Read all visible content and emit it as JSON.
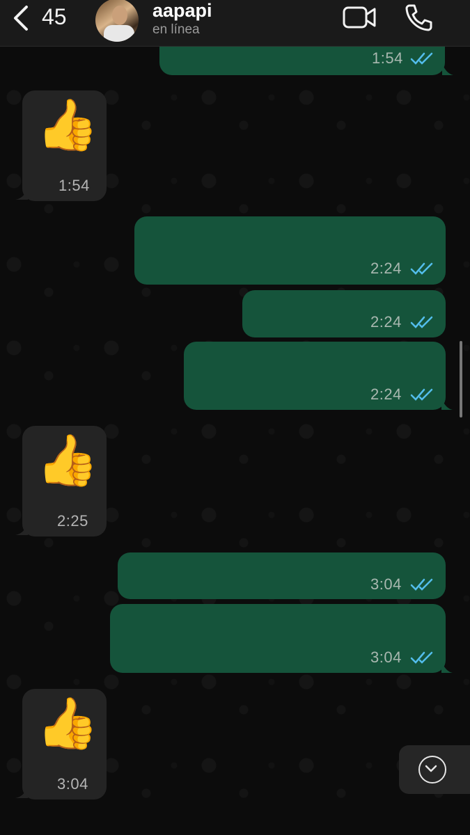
{
  "header": {
    "back_count": "45",
    "contact_name": "aapapi",
    "status": "en línea"
  },
  "messages": [
    {
      "dir": "out",
      "time": "1:54",
      "read": true
    },
    {
      "dir": "in",
      "emoji": "👍",
      "time": "1:54"
    },
    {
      "dir": "out",
      "time": "2:24",
      "read": true
    },
    {
      "dir": "out",
      "time": "2:24",
      "read": true
    },
    {
      "dir": "out",
      "time": "2:24",
      "read": true
    },
    {
      "dir": "in",
      "emoji": "👍",
      "time": "2:25"
    },
    {
      "dir": "out",
      "time": "3:04",
      "read": true
    },
    {
      "dir": "out",
      "time": "3:04",
      "read": true
    },
    {
      "dir": "in",
      "emoji": "👍",
      "time": "3:04"
    }
  ],
  "colors": {
    "outgoing_bubble": "#15543b",
    "incoming_bubble": "#242424",
    "read_ticks": "#53bdeb",
    "header": "#1a1a1a"
  },
  "icons": {
    "back": "chevron-left-icon",
    "video": "video-camera-icon",
    "call": "phone-icon",
    "scroll_down": "chevron-down-icon",
    "read": "double-check-icon"
  }
}
